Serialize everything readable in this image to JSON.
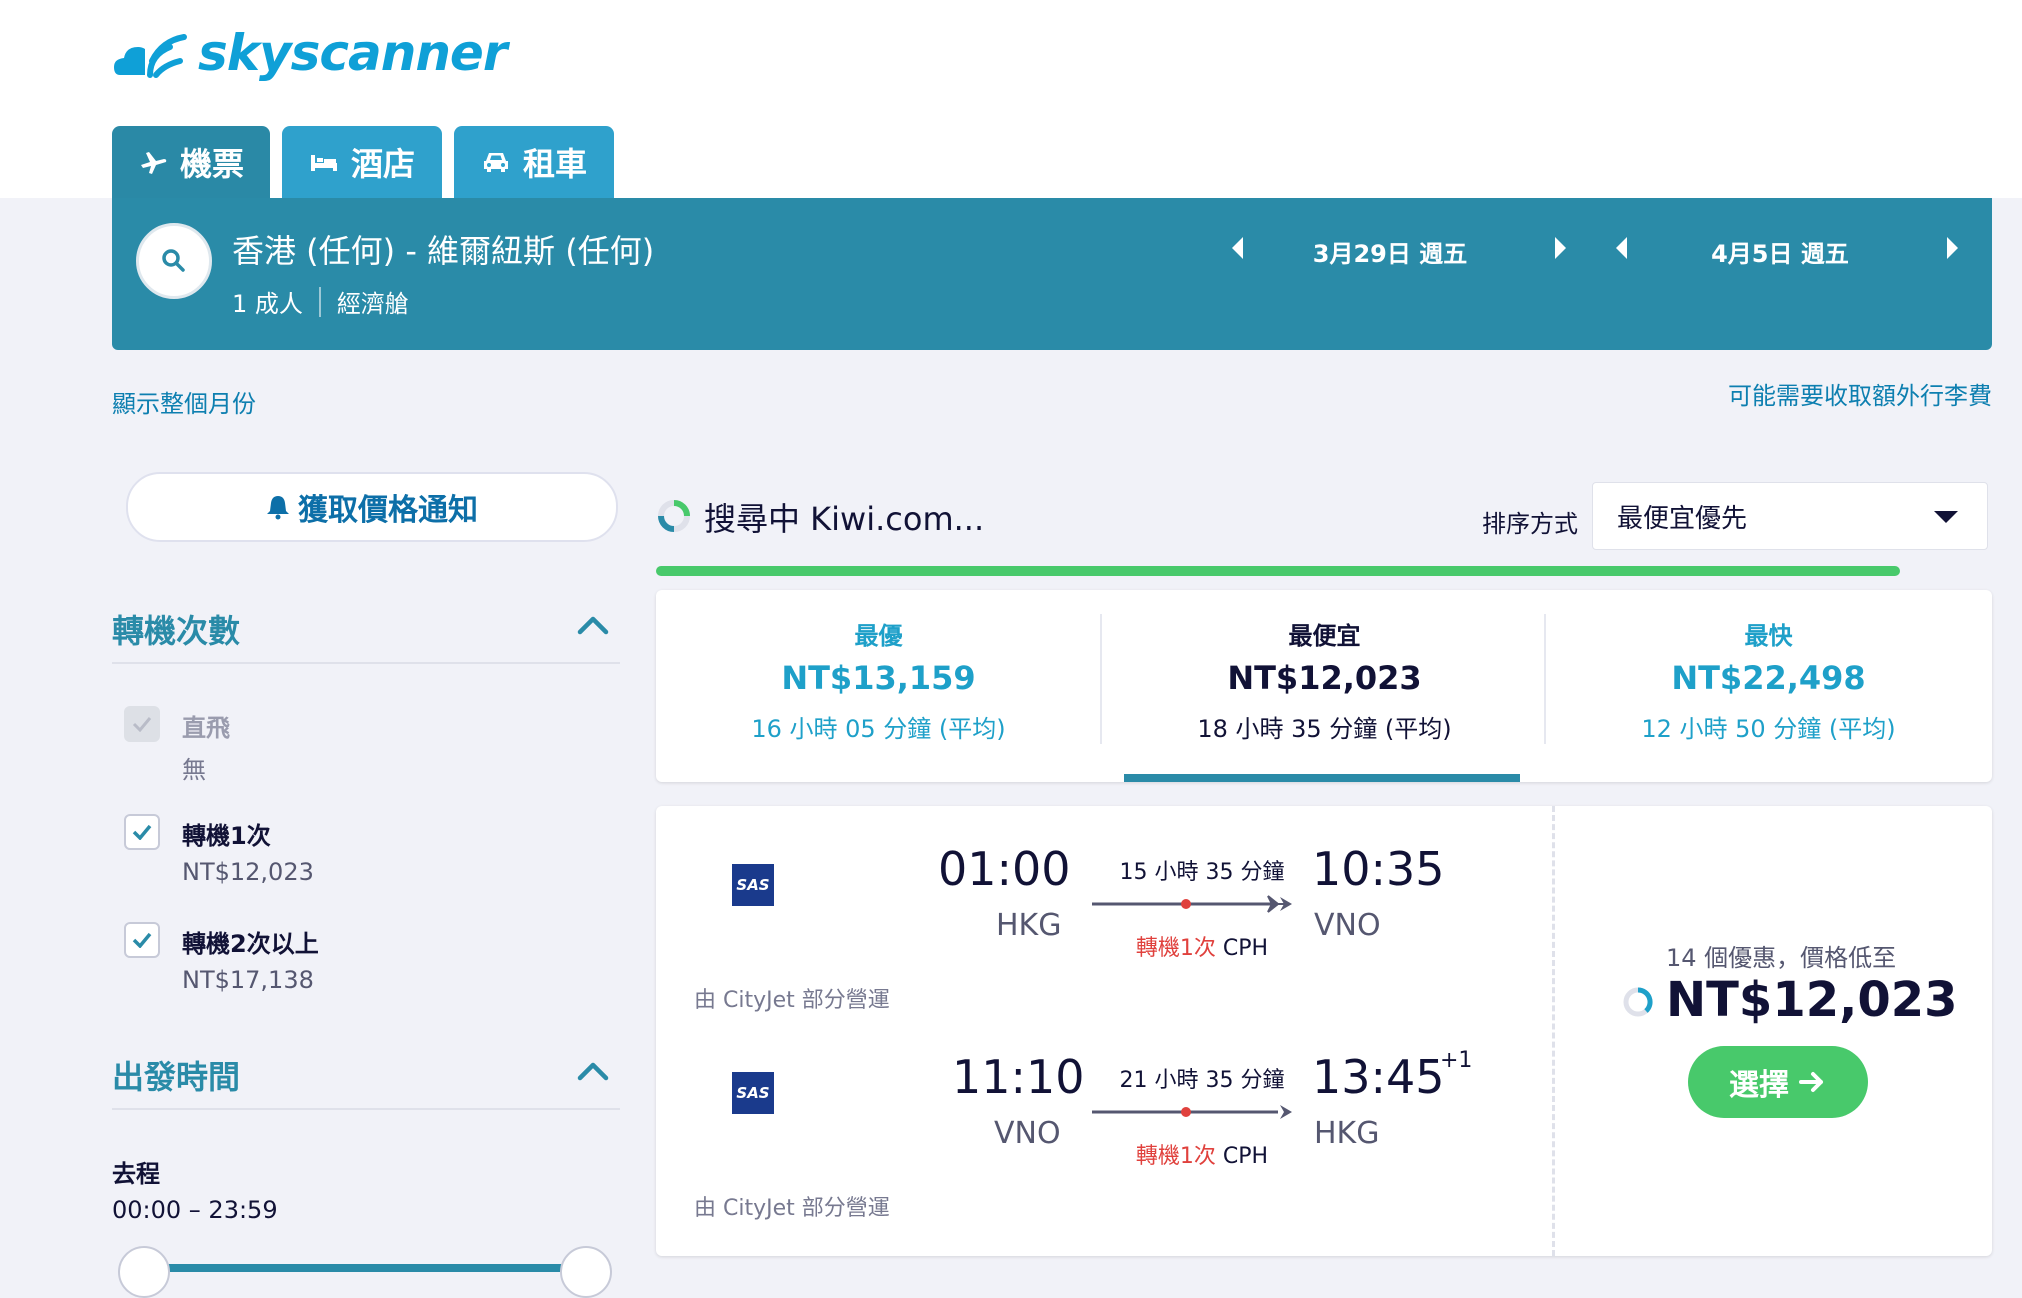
{
  "brand": {
    "name": "skyscanner",
    "color": "#0fa0d7"
  },
  "tabs": [
    {
      "label": "機票",
      "icon": "plane-icon",
      "active": true
    },
    {
      "label": "酒店",
      "icon": "bed-icon",
      "active": false
    },
    {
      "label": "租車",
      "icon": "car-icon",
      "active": false
    }
  ],
  "search": {
    "route": "香港 (任何) - 維爾紐斯 (任何)",
    "passengers": "1 成人",
    "cabin": "經濟艙",
    "depart_date": "3月29日 週五",
    "return_date": "4月5日 週五"
  },
  "links": {
    "show_month": "顯示整個月份",
    "baggage": "可能需要收取額外行李費"
  },
  "left_panel": {
    "alert_button": "獲取價格通知",
    "stops_title": "轉機次數",
    "stops_options": [
      {
        "label": "直飛",
        "price": "無",
        "checked": true,
        "disabled": true
      },
      {
        "label": "轉機1次",
        "price": "NT$12,023",
        "checked": true,
        "disabled": false
      },
      {
        "label": "轉機2次以上",
        "price": "NT$17,138",
        "checked": true,
        "disabled": false
      }
    ],
    "depart_time_title": "出發時間",
    "outbound_label": "去程",
    "outbound_range": "00:00 – 23:59"
  },
  "results_header": {
    "loading_text": "搜尋中 Kiwi.com...",
    "sort_label": "排序方式",
    "sort_value": "最便宜優先",
    "progress": 1.0
  },
  "summary": [
    {
      "title": "最優",
      "price": "NT$13,159",
      "duration": "16 小時 05 分鐘 (平均)"
    },
    {
      "title": "最便宜",
      "price": "NT$12,023",
      "duration": "18 小時 35 分鐘 (平均)"
    },
    {
      "title": "最快",
      "price": "NT$22,498",
      "duration": "12 小時 50 分鐘 (平均)"
    }
  ],
  "result": {
    "legs": [
      {
        "airline": "SAS",
        "depart_time": "01:00",
        "depart_airport": "HKG",
        "duration": "15 小時 35 分鐘",
        "stops_red": "轉機1次",
        "stops_via": "CPH",
        "arrive_time": "10:35",
        "arrive_airport": "VNO",
        "day_offset": "",
        "operated_by": "由 CityJet 部分營運"
      },
      {
        "airline": "SAS",
        "depart_time": "11:10",
        "depart_airport": "VNO",
        "duration": "21 小時 35 分鐘",
        "stops_red": "轉機1次",
        "stops_via": "CPH",
        "arrive_time": "13:45",
        "arrive_airport": "HKG",
        "day_offset": "+1",
        "operated_by": "由 CityJet 部分營運"
      }
    ],
    "deals_text": "14 個優惠，價格低至",
    "price": "NT$12,023",
    "select_label": "選擇"
  },
  "colors": {
    "primary": "#2a8ba8",
    "tab_inactive": "#2fa1cc",
    "accent_blue": "#1ea0c9",
    "green": "#48c96b",
    "red": "#e0413d"
  }
}
